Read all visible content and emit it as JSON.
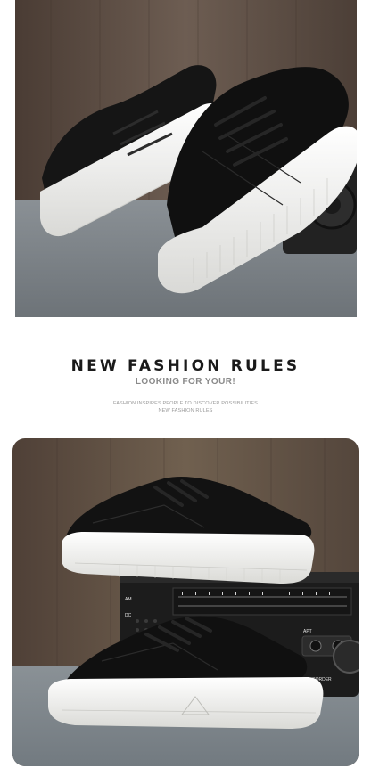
{
  "heading": {
    "title": "NEW FASHION RULES",
    "subtitle": "LOOKING FOR YOUR!",
    "tagline_line1": "FASHION INSPIRES PEOPLE TO DISCOVER POSSIBILITIES",
    "tagline_line2": "NEW FASHION RULES"
  },
  "radio": {
    "label_corder": "CORDER",
    "label_dc": "DC",
    "label_am": "AM",
    "label_ac": "AC",
    "label_apt": "APT"
  },
  "colors": {
    "wall": "#5a4a40",
    "floor": "#7f858a",
    "shoe_upper": "#121212",
    "sole": "#f4f4f2",
    "radio_body": "#1c1c1c"
  }
}
